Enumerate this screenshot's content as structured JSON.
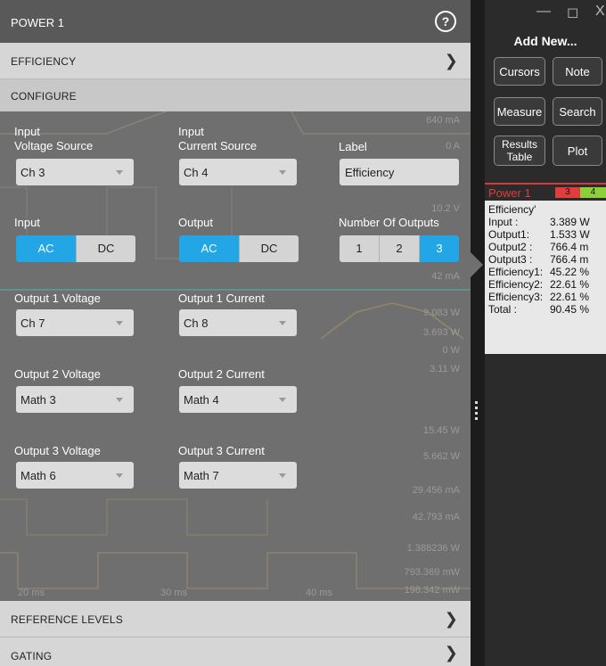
{
  "window": {
    "title": "POWER 1",
    "help_icon": "?"
  },
  "sections": {
    "efficiency": "EFFICIENCY",
    "configure": "CONFIGURE",
    "reference_levels": "REFERENCE LEVELS",
    "gating": "GATING"
  },
  "chevron": "❯",
  "configure": {
    "input_voltage_label_l1": "Input",
    "input_voltage_label_l2": "Voltage Source",
    "input_voltage_value": "Ch 3",
    "input_current_label_l1": "Input",
    "input_current_label_l2": "Current Source",
    "input_current_value": "Ch 4",
    "label_label": "Label",
    "label_value": "Efficiency",
    "input_label": "Input",
    "input_ac": "AC",
    "input_dc": "DC",
    "output_label": "Output",
    "output_ac": "AC",
    "output_dc": "DC",
    "num_outputs_label": "Number Of Outputs",
    "num_outputs_options": [
      "1",
      "2",
      "3"
    ],
    "out1_voltage_label": "Output 1 Voltage",
    "out1_voltage_value": "Ch 7",
    "out1_current_label": "Output 1 Current",
    "out1_current_value": "Ch 8",
    "out2_voltage_label": "Output 2 Voltage",
    "out2_voltage_value": "Math 3",
    "out2_current_label": "Output 2 Current",
    "out2_current_value": "Math 4",
    "out3_voltage_label": "Output 3 Voltage",
    "out3_voltage_value": "Math 6",
    "out3_current_label": "Output 3 Current",
    "out3_current_value": "Math 7"
  },
  "background_readouts": [
    "640 mA",
    "0 A",
    "10.2 V",
    "42 mA",
    "9.083 W",
    "3.693 W",
    "0 W",
    "3.11 W",
    "15.45 W",
    "5.662 W",
    "29.456 mA",
    "42.793 mA",
    "1.388236 W",
    "793.369 mW",
    "198.342 mW"
  ],
  "background_time_ticks": [
    "20 ms",
    "30 ms",
    "40 ms"
  ],
  "right_panel": {
    "window_buttons": [
      "—",
      "◻",
      "X"
    ],
    "add_new": "Add New...",
    "buttons": {
      "cursors": "Cursors",
      "note": "Note",
      "measure": "Measure",
      "search": "Search",
      "results_table_l1": "Results",
      "results_table_l2": "Table",
      "plot": "Plot"
    }
  },
  "badge": {
    "name": "Power 1",
    "chip1": "3",
    "chip2": "4",
    "heading": "Efficiency'",
    "rows": [
      {
        "k": "Input :",
        "v": "3.389 W"
      },
      {
        "k": "Output1:",
        "v": "1.533 W"
      },
      {
        "k": "Output2 :",
        "v": "766.4 m"
      },
      {
        "k": "Output3 :",
        "v": "766.4 m"
      },
      {
        "k": "Efficiency1:",
        "v": "45.22 %"
      },
      {
        "k": "Efficiency2:",
        "v": "22.61 %"
      },
      {
        "k": "Efficiency3:",
        "v": "22.61 %"
      },
      {
        "k": "Total :",
        "v": "90.45 %"
      }
    ]
  },
  "colors": {
    "accent": "#22a6e6",
    "badge_red": "#e23c3c",
    "chip_green": "#8ccf3a",
    "chip_red": "#e23c3c"
  }
}
